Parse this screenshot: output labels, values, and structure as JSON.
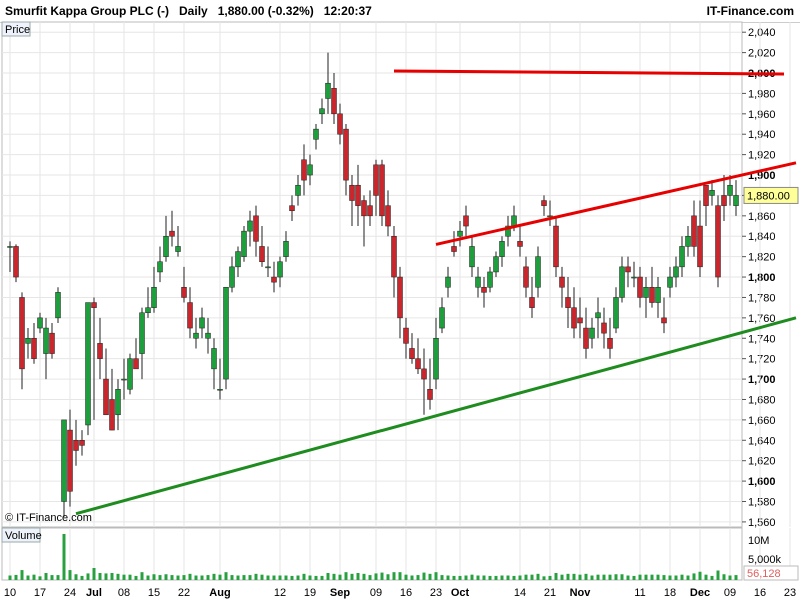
{
  "header": {
    "instrument": "Smurfit Kappa Group PLC (-)",
    "period": "Daily",
    "last_change": "1,880.00 (-0.32%)",
    "time": "12:20:37",
    "brand": "IT-Finance.com"
  },
  "panel_labels": {
    "price": "Price",
    "volume": "Volume",
    "watermark": "© IT-Finance.com"
  },
  "colors": {
    "up": "#1e9e3c",
    "down": "#c8282d",
    "resistance": "#e60000",
    "support": "#1e8c1e",
    "grid": "#e6e6e6"
  },
  "chart_data": {
    "type": "candlestick",
    "y_axis": {
      "ylim": [
        1555,
        2050
      ],
      "ticks": [
        1560,
        1580,
        1600,
        1620,
        1640,
        1660,
        1680,
        1700,
        1720,
        1740,
        1760,
        1780,
        1800,
        1820,
        1840,
        1860,
        1880,
        1900,
        1920,
        1940,
        1960,
        1980,
        2000,
        2020,
        2040
      ],
      "tick_labels": [
        "1,560",
        "1,580",
        "1,600",
        "1,620",
        "1,640",
        "1,660",
        "1,680",
        "1,700",
        "1,720",
        "1,740",
        "1,760",
        "1,780",
        "1,800",
        "1,820",
        "1,840",
        "1,860",
        "1,880",
        "1,900",
        "1,920",
        "1,940",
        "1,960",
        "1,980",
        "2,000",
        "2,020",
        "2,040"
      ],
      "bold_ticks": [
        1600,
        1700,
        1800,
        1900,
        2000
      ],
      "last_price_label": "1,880.00",
      "last_price": 1880
    },
    "x_axis": {
      "labels": [
        "10",
        "17",
        "24",
        "Jul",
        "08",
        "15",
        "22",
        "Aug",
        "12",
        "19",
        "Sep",
        "09",
        "16",
        "23",
        "Oct",
        "14",
        "21",
        "Nov",
        "11",
        "18",
        "Dec",
        "09",
        "16",
        "23"
      ],
      "bold_labels": [
        "Jul",
        "Aug",
        "Sep",
        "Oct",
        "Nov",
        "Dec"
      ],
      "label_bar_index": [
        0,
        5,
        10,
        14,
        19,
        24,
        29,
        35,
        45,
        50,
        55,
        61,
        66,
        71,
        75,
        85,
        90,
        95,
        105,
        110,
        115,
        120,
        125,
        130
      ]
    },
    "candles": [
      [
        1830,
        1835,
        1805,
        1830
      ],
      [
        1830,
        1832,
        1795,
        1800
      ],
      [
        1780,
        1785,
        1690,
        1710
      ],
      [
        1735,
        1750,
        1720,
        1740
      ],
      [
        1740,
        1755,
        1715,
        1720
      ],
      [
        1750,
        1765,
        1745,
        1760
      ],
      [
        1725,
        1760,
        1700,
        1750
      ],
      [
        1745,
        1755,
        1720,
        1725
      ],
      [
        1760,
        1790,
        1755,
        1785
      ],
      [
        1580,
        1640,
        1565,
        1660
      ],
      [
        1650,
        1670,
        1575,
        1590
      ],
      [
        1640,
        1660,
        1615,
        1630
      ],
      [
        1640,
        1650,
        1625,
        1635
      ],
      [
        1655,
        1700,
        1645,
        1775
      ],
      [
        1775,
        1780,
        1660,
        1770
      ],
      [
        1735,
        1760,
        1700,
        1720
      ],
      [
        1700,
        1730,
        1675,
        1665
      ],
      [
        1680,
        1710,
        1650,
        1650
      ],
      [
        1665,
        1700,
        1650,
        1690
      ],
      [
        1700,
        1720,
        1680,
        1700
      ],
      [
        1690,
        1725,
        1685,
        1720
      ],
      [
        1720,
        1740,
        1715,
        1710
      ],
      [
        1725,
        1770,
        1700,
        1765
      ],
      [
        1765,
        1790,
        1760,
        1770
      ],
      [
        1770,
        1810,
        1765,
        1790
      ],
      [
        1805,
        1830,
        1795,
        1815
      ],
      [
        1820,
        1860,
        1815,
        1840
      ],
      [
        1845,
        1865,
        1830,
        1840
      ],
      [
        1825,
        1850,
        1820,
        1830
      ],
      [
        1790,
        1810,
        1775,
        1780
      ],
      [
        1775,
        1790,
        1740,
        1750
      ],
      [
        1740,
        1760,
        1730,
        1745
      ],
      [
        1750,
        1770,
        1740,
        1760
      ],
      [
        1740,
        1760,
        1725,
        1745
      ],
      [
        1710,
        1740,
        1690,
        1730
      ],
      [
        1690,
        1720,
        1680,
        1690
      ],
      [
        1700,
        1760,
        1690,
        1790
      ],
      [
        1790,
        1820,
        1785,
        1810
      ],
      [
        1810,
        1830,
        1800,
        1825
      ],
      [
        1820,
        1850,
        1815,
        1845
      ],
      [
        1845,
        1865,
        1830,
        1855
      ],
      [
        1860,
        1870,
        1820,
        1835
      ],
      [
        1830,
        1850,
        1810,
        1815
      ],
      [
        1810,
        1830,
        1800,
        1810
      ],
      [
        1800,
        1815,
        1785,
        1795
      ],
      [
        1800,
        1820,
        1790,
        1815
      ],
      [
        1820,
        1845,
        1815,
        1835
      ],
      [
        1870,
        1880,
        1855,
        1865
      ],
      [
        1880,
        1900,
        1870,
        1890
      ],
      [
        1915,
        1930,
        1880,
        1895
      ],
      [
        1900,
        1920,
        1890,
        1910
      ],
      [
        1935,
        1950,
        1925,
        1945
      ],
      [
        1960,
        1975,
        1950,
        1965
      ],
      [
        1975,
        2020,
        1960,
        1990
      ],
      [
        1985,
        2000,
        1950,
        1960
      ],
      [
        1960,
        1970,
        1930,
        1940
      ],
      [
        1945,
        1950,
        1880,
        1895
      ],
      [
        1890,
        1900,
        1850,
        1875
      ],
      [
        1890,
        1910,
        1850,
        1870
      ],
      [
        1875,
        1880,
        1830,
        1860
      ],
      [
        1870,
        1885,
        1850,
        1860
      ],
      [
        1910,
        1915,
        1860,
        1880
      ],
      [
        1910,
        1915,
        1850,
        1860
      ],
      [
        1870,
        1885,
        1840,
        1850
      ],
      [
        1840,
        1850,
        1780,
        1800
      ],
      [
        1800,
        1810,
        1740,
        1760
      ],
      [
        1750,
        1760,
        1720,
        1735
      ],
      [
        1730,
        1745,
        1715,
        1720
      ],
      [
        1720,
        1740,
        1705,
        1710
      ],
      [
        1710,
        1730,
        1665,
        1700
      ],
      [
        1690,
        1720,
        1670,
        1680
      ],
      [
        1700,
        1760,
        1690,
        1740
      ],
      [
        1750,
        1780,
        1745,
        1770
      ],
      [
        1790,
        1810,
        1780,
        1800
      ],
      [
        1830,
        1845,
        1820,
        1825
      ],
      [
        1840,
        1855,
        1830,
        1845
      ],
      [
        1860,
        1870,
        1840,
        1850
      ],
      [
        1810,
        1840,
        1800,
        1830
      ],
      [
        1790,
        1810,
        1780,
        1800
      ],
      [
        1790,
        1800,
        1770,
        1785
      ],
      [
        1790,
        1810,
        1785,
        1805
      ],
      [
        1805,
        1825,
        1800,
        1820
      ],
      [
        1820,
        1840,
        1810,
        1835
      ],
      [
        1840,
        1860,
        1830,
        1850
      ],
      [
        1850,
        1870,
        1845,
        1860
      ],
      [
        1835,
        1850,
        1820,
        1830
      ],
      [
        1810,
        1820,
        1780,
        1790
      ],
      [
        1780,
        1800,
        1760,
        1770
      ],
      [
        1790,
        1830,
        1780,
        1820
      ],
      [
        1875,
        1880,
        1860,
        1870
      ],
      [
        1860,
        1875,
        1850,
        1860
      ],
      [
        1850,
        1860,
        1800,
        1810
      ],
      [
        1800,
        1810,
        1770,
        1790
      ],
      [
        1780,
        1800,
        1750,
        1770
      ],
      [
        1770,
        1790,
        1740,
        1750
      ],
      [
        1760,
        1780,
        1740,
        1755
      ],
      [
        1750,
        1770,
        1720,
        1730
      ],
      [
        1740,
        1760,
        1730,
        1750
      ],
      [
        1760,
        1780,
        1740,
        1765
      ],
      [
        1755,
        1770,
        1730,
        1745
      ],
      [
        1740,
        1760,
        1720,
        1730
      ],
      [
        1750,
        1790,
        1745,
        1780
      ],
      [
        1780,
        1820,
        1775,
        1810
      ],
      [
        1810,
        1820,
        1790,
        1805
      ],
      [
        1800,
        1815,
        1790,
        1800
      ],
      [
        1800,
        1810,
        1770,
        1780
      ],
      [
        1780,
        1800,
        1760,
        1790
      ],
      [
        1790,
        1810,
        1770,
        1775
      ],
      [
        1775,
        1800,
        1760,
        1790
      ],
      [
        1760,
        1780,
        1745,
        1755
      ],
      [
        1790,
        1810,
        1780,
        1800
      ],
      [
        1800,
        1820,
        1790,
        1810
      ],
      [
        1810,
        1840,
        1800,
        1830
      ],
      [
        1830,
        1850,
        1820,
        1840
      ],
      [
        1860,
        1875,
        1820,
        1830
      ],
      [
        1850,
        1875,
        1800,
        1810
      ],
      [
        1890,
        1890,
        1850,
        1870
      ],
      [
        1880,
        1895,
        1870,
        1885
      ],
      [
        1870,
        1880,
        1790,
        1800
      ],
      [
        1880,
        1900,
        1855,
        1870
      ],
      [
        1880,
        1900,
        1870,
        1890
      ],
      [
        1870,
        1895,
        1860,
        1880
      ]
    ],
    "volume": {
      "ticks": [
        "10M",
        "5,000k"
      ],
      "last_label": "56,128"
    },
    "trendlines": [
      {
        "kind": "resistance",
        "start_bar": 64,
        "start_price": 2002,
        "end_bar": 129,
        "end_price": 1999
      },
      {
        "kind": "resistance",
        "start_bar": 71,
        "start_price": 1832,
        "end_bar": 131,
        "end_price": 1912
      },
      {
        "kind": "support",
        "start_bar": 11,
        "start_price": 1568,
        "end_bar": 131,
        "end_price": 1760
      }
    ]
  }
}
